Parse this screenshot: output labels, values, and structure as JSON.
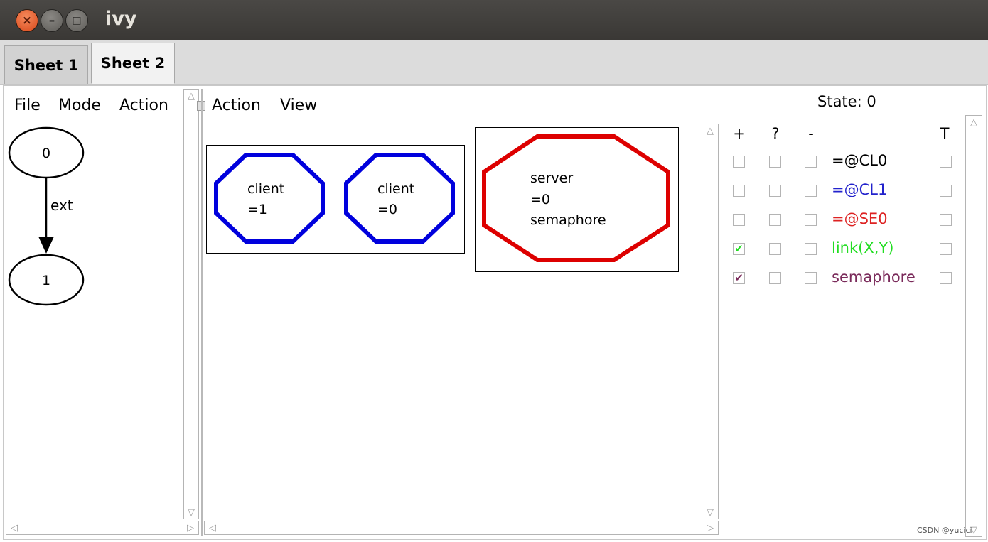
{
  "window": {
    "title": "ivy",
    "close_glyph": "×",
    "min_glyph": "–",
    "max_glyph": "□"
  },
  "tabs": [
    {
      "label": "Sheet 1"
    },
    {
      "label": "Sheet 2"
    }
  ],
  "left_panel": {
    "menu": [
      "File",
      "Mode",
      "Action"
    ],
    "graph": {
      "nodes": [
        "0",
        "1"
      ],
      "edge_label": "ext"
    }
  },
  "middle_panel": {
    "menu": [
      "Action",
      "View"
    ],
    "groups": [
      {
        "nodes": [
          {
            "lines": [
              "client",
              "=1"
            ],
            "color": "#0000dd"
          },
          {
            "lines": [
              "client",
              "=0"
            ],
            "color": "#0000dd"
          }
        ]
      },
      {
        "nodes": [
          {
            "lines": [
              "server",
              "=0",
              "semaphore"
            ],
            "color": "#dd0000"
          }
        ]
      }
    ]
  },
  "right_panel": {
    "state_label": "State: 0",
    "columns": [
      "+",
      "?",
      "-",
      "T"
    ],
    "rows": [
      {
        "label": "=@CL0",
        "color": "#000000",
        "plus": false,
        "plus_color": "",
        "q": false,
        "minus": false,
        "t": false
      },
      {
        "label": "=@CL1",
        "color": "#2222cc",
        "plus": false,
        "plus_color": "",
        "q": false,
        "minus": false,
        "t": false
      },
      {
        "label": "=@SE0",
        "color": "#dd2222",
        "plus": false,
        "plus_color": "",
        "q": false,
        "minus": false,
        "t": false
      },
      {
        "label": "link(X,Y)",
        "color": "#22dd22",
        "plus": true,
        "plus_color": "#22dd22",
        "q": false,
        "minus": false,
        "t": false
      },
      {
        "label": "semaphore",
        "color": "#7a2a5a",
        "plus": true,
        "plus_color": "#7a2a5a",
        "q": false,
        "minus": false,
        "t": false
      }
    ]
  },
  "watermark": "CSDN @yucici",
  "scroll_arrows": {
    "up": "△",
    "down": "▽",
    "left": "◁",
    "right": "▷"
  }
}
